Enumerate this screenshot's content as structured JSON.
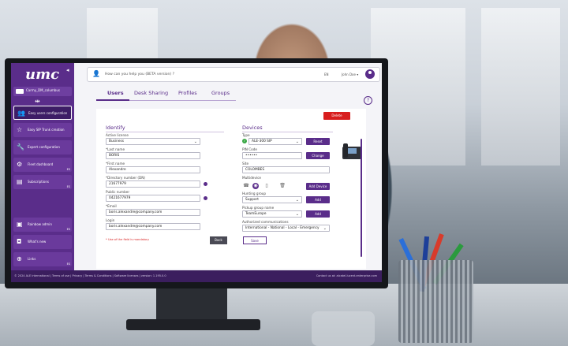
{
  "app": {
    "logo": "umc",
    "company_name": "Carmy_DM_columbus",
    "ask_placeholder": "How can you help you (BETA version) ?",
    "lang": "EN",
    "user_name": "John Doe",
    "user_chevron": "▾"
  },
  "sidebar": {
    "items": [
      {
        "label": "Easy users configuration",
        "icon": "users-icon",
        "badge": ""
      },
      {
        "label": "Easy SIP Trunk creation",
        "icon": "star-icon",
        "badge": ""
      },
      {
        "label": "Expert configuration",
        "icon": "wrench-icon",
        "badge": ""
      },
      {
        "label": "Fleet dashboard",
        "icon": "dashboard-icon",
        "badge": "ES"
      },
      {
        "label": "Subscriptions",
        "icon": "subscription-icon",
        "badge": "ES"
      },
      {
        "label": "Rainbow admin",
        "icon": "rainbow-icon",
        "badge": "ES"
      },
      {
        "label": "What's new",
        "icon": "news-icon",
        "badge": ""
      },
      {
        "label": "Links",
        "icon": "link-icon",
        "badge": "ES"
      }
    ]
  },
  "tabs": [
    {
      "label": "Users"
    },
    {
      "label": "Desk Sharing"
    },
    {
      "label": "Profiles"
    },
    {
      "label": "Groups"
    }
  ],
  "identify": {
    "title": "Identify",
    "active_license_label": "Active license",
    "active_license_value": "Business",
    "last_name_label": "*Last name",
    "last_name_value": "BORIS",
    "first_name_label": "*First name",
    "first_name_value": "Alexandre",
    "dn_label": "*Directory number (DN)",
    "dn_value": "21677979",
    "public_number_label": "Public number",
    "public_number_value": "0421677979",
    "email_label": "*Email",
    "email_value": "boris.alexandre@company.com",
    "login_label": "Login",
    "login_value": "boris.alexandre@company.com",
    "mandatory_note": "* Use of the field is mandatory"
  },
  "devices": {
    "title": "Devices",
    "type_label": "Type",
    "type_value": "ALE-300 SIP",
    "reset_label": "Reset",
    "pin_label": "PIN Code",
    "pin_value": "••••••",
    "change_label": "Change",
    "site_label": "Site",
    "site_value": "COLOMBES",
    "multidevice_label": "Multidevice",
    "add_device_label": "Add Device",
    "hunting_label": "Hunting group",
    "hunting_value": "Support",
    "add_label": "Add",
    "pickup_label": "Pickup group name",
    "pickup_value": "TeamEurope",
    "authorized_label": "Authorized communications",
    "authorized_value": "International - National - Local - Emergency"
  },
  "actions": {
    "delete_label": "Delete",
    "back_label": "Back",
    "save_label": "Save"
  },
  "footer": {
    "left": "© 2024 ALE International | Terms of use | Privacy | Terms & Conditions | Software licenses | version: 1.195.0.0",
    "right": "Contact us at: alcatel-lucent.enterprise.com"
  },
  "colors": {
    "brand": "#5a2d8a",
    "danger": "#d81e1e",
    "success": "#3aa845"
  }
}
